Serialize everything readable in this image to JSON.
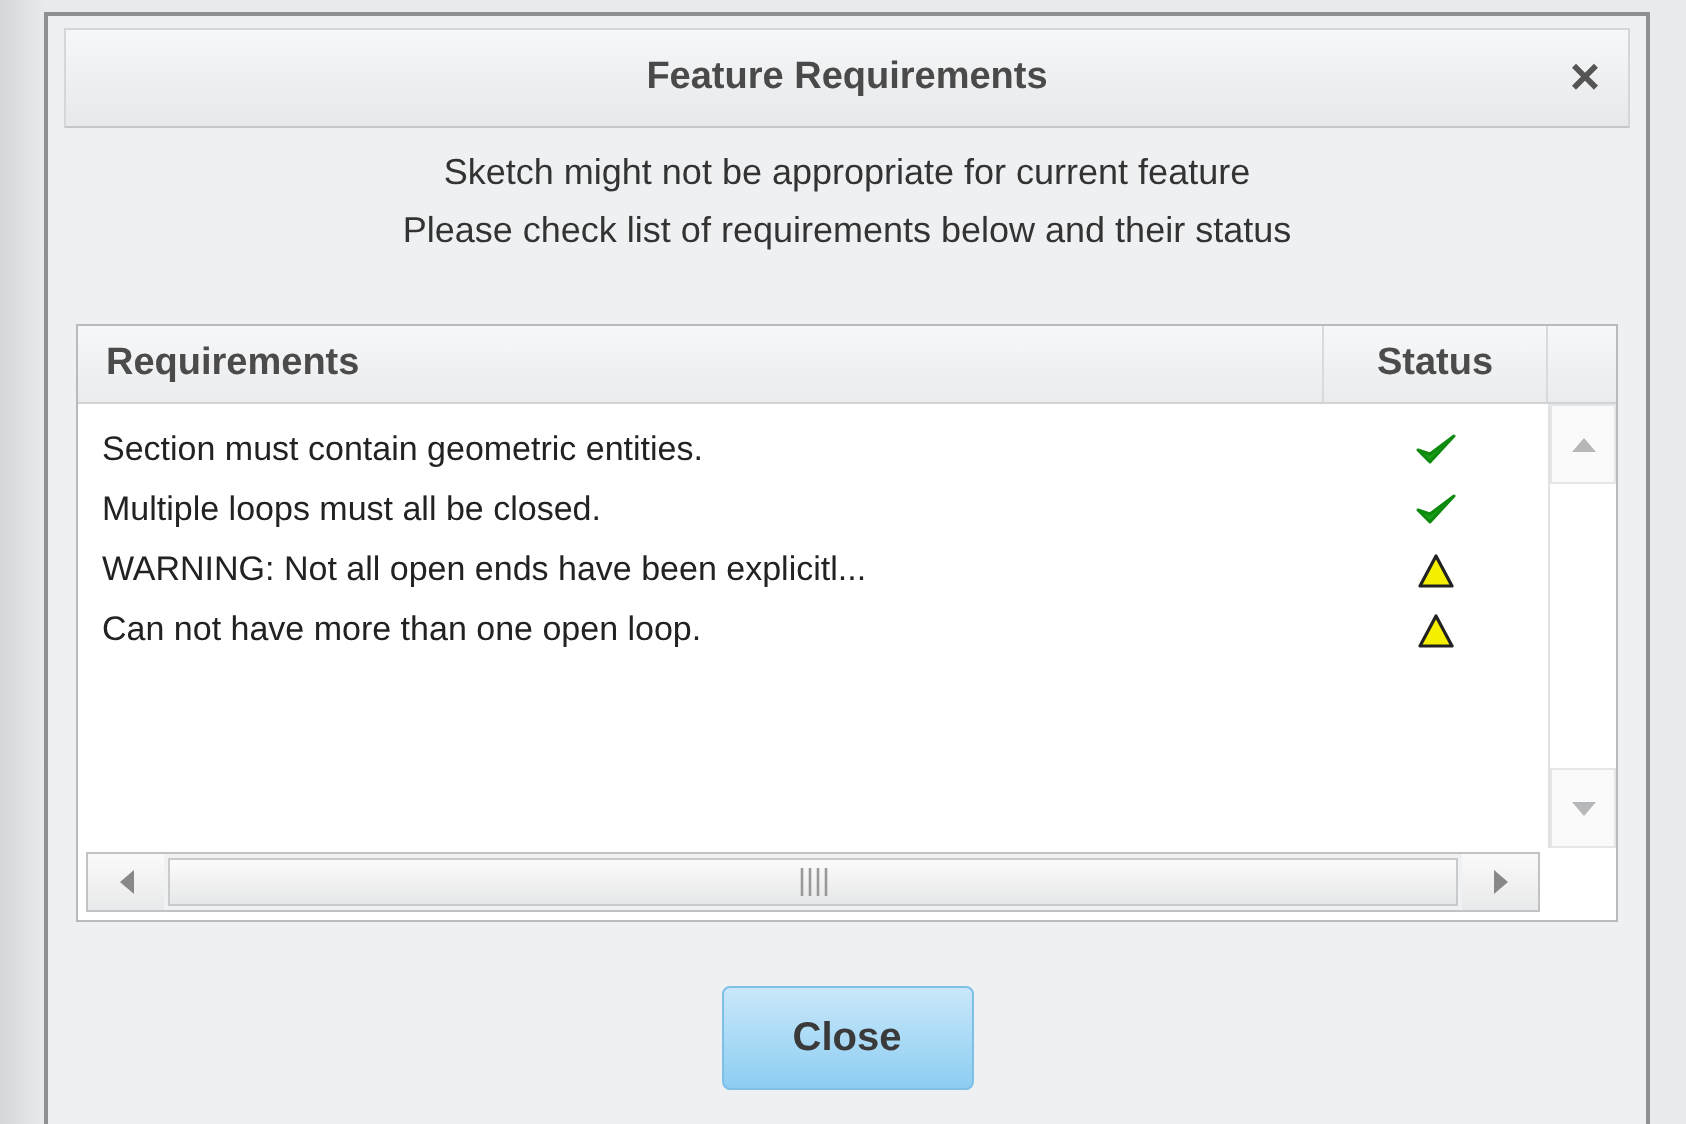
{
  "window": {
    "title": "Feature Requirements",
    "close_label": "×"
  },
  "message": [
    "Sketch might not be appropriate for current feature",
    "Please check list of requirements below and their status"
  ],
  "table": {
    "columns": [
      "Requirements",
      "Status"
    ],
    "rows": [
      {
        "requirement": "Section must contain geometric entities.",
        "kind": "ok"
      },
      {
        "requirement": "Multiple loops must all be closed.",
        "kind": "ok"
      },
      {
        "requirement": "WARNING: Not all open ends have been explicitl...",
        "kind": "warning"
      },
      {
        "requirement": "Can not have more than one open loop.",
        "kind": "warning"
      }
    ]
  },
  "buttons": [
    "Close"
  ]
}
